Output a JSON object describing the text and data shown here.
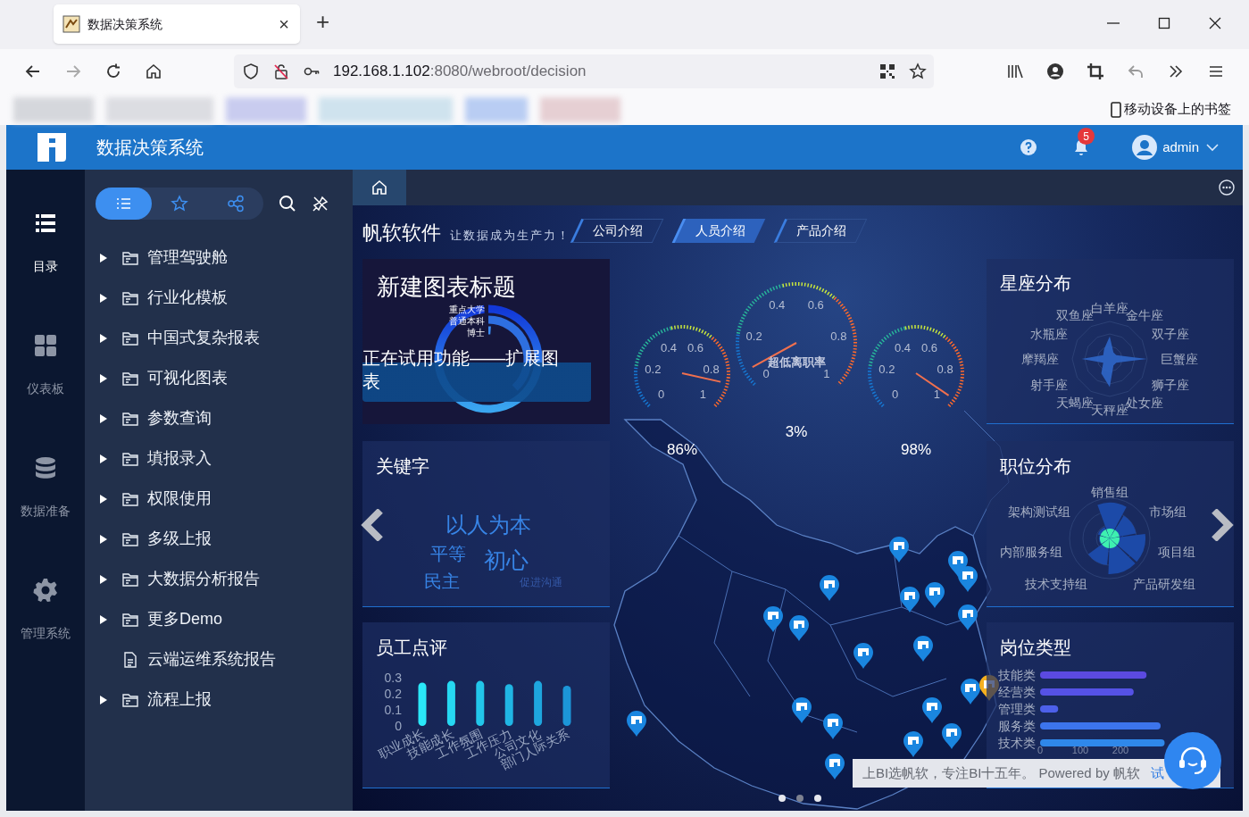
{
  "browser": {
    "tab_title": "数据决策系统",
    "tab_close": "×",
    "new_tab": "+",
    "url_host": "192.168.1.102",
    "url_rest": ":8080/webroot/decision",
    "bookmark": "移动设备上的书签"
  },
  "app": {
    "title": "数据决策系统",
    "notifications": "5",
    "user": "admin"
  },
  "nav": [
    {
      "label": "目录",
      "kind": "list",
      "selected": true
    },
    {
      "label": "仪表板",
      "kind": "dashboard",
      "selected": false
    },
    {
      "label": "数据准备",
      "kind": "database",
      "selected": false
    },
    {
      "label": "管理系统",
      "kind": "gear",
      "selected": false
    }
  ],
  "panel_tabs": [
    {
      "kind": "list",
      "selected": true
    },
    {
      "kind": "star",
      "selected": false
    },
    {
      "kind": "share",
      "selected": false
    }
  ],
  "tree": [
    {
      "label": "管理驾驶舱",
      "kind": "folder"
    },
    {
      "label": "行业化模板",
      "kind": "folder"
    },
    {
      "label": "中国式复杂报表",
      "kind": "folder"
    },
    {
      "label": "可视化图表",
      "kind": "folder"
    },
    {
      "label": "参数查询",
      "kind": "folder"
    },
    {
      "label": "填报录入",
      "kind": "folder"
    },
    {
      "label": "权限使用",
      "kind": "folder"
    },
    {
      "label": "多级上报",
      "kind": "folder"
    },
    {
      "label": "大数据分析报告",
      "kind": "folder"
    },
    {
      "label": "更多Demo",
      "kind": "folder"
    },
    {
      "label": "云端运维系统报告",
      "kind": "file"
    },
    {
      "label": "流程上报",
      "kind": "folder"
    }
  ],
  "dashboard": {
    "brand": "帆软软件",
    "slogan": "让数据成为生产力！",
    "tabs": [
      {
        "label": "公司介绍",
        "selected": false
      },
      {
        "label": "人员介绍",
        "selected": true
      },
      {
        "label": "产品介绍",
        "selected": false
      }
    ],
    "rings_card": {
      "title": "新建图表标题",
      "labels": [
        "重点大学",
        "普通本科",
        "博士"
      ],
      "trial_notice": "正在试用功能——扩展图表"
    },
    "gauges": [
      {
        "ticks": [
          "0",
          "0.2",
          "0.4",
          "0.6",
          "0.8",
          "1"
        ],
        "value": "86%"
      },
      {
        "ticks": [
          "0",
          "0.2",
          "0.4",
          "0.6",
          "0.8",
          "1"
        ],
        "title": "超低离职率",
        "value": "3%"
      },
      {
        "ticks": [
          "0",
          "0.2",
          "0.4",
          "0.6",
          "0.8",
          "1"
        ],
        "value": "98%"
      }
    ],
    "keywords_card": {
      "title": "关键字",
      "words": [
        "以人为本",
        "平等",
        "初心",
        "民主",
        "促进沟通"
      ]
    },
    "reviews_card": {
      "title": "员工点评",
      "chart_data": {
        "type": "bar",
        "categories": [
          "职业成长",
          "技能成长",
          "工作氛围",
          "工作压力",
          "公司文化",
          "部门人际关系"
        ],
        "values": [
          0.27,
          0.28,
          0.28,
          0.26,
          0.28,
          0.25
        ],
        "ylim": [
          0,
          0.3
        ],
        "yticks": [
          0,
          0.1,
          0.2,
          0.3
        ]
      }
    },
    "zodiac_card": {
      "title": "星座分布",
      "labels": [
        "白羊座",
        "金牛座",
        "双子座",
        "巨蟹座",
        "狮子座",
        "处女座",
        "天秤座",
        "天蝎座",
        "射手座",
        "摩羯座",
        "水瓶座",
        "双鱼座"
      ]
    },
    "roles_card": {
      "title": "职位分布",
      "labels": [
        "销售组",
        "架构测试组",
        "市场组",
        "内部服务组",
        "项目组",
        "技术支持组",
        "产品研发组"
      ]
    },
    "jobs_card": {
      "title": "岗位类型",
      "chart_data": {
        "type": "bar",
        "orientation": "horizontal",
        "categories": [
          "技能类",
          "经营类",
          "管理类",
          "服务类",
          "技术类"
        ],
        "values": [
          265,
          233,
          45,
          300,
          310
        ],
        "xticks": [
          0,
          100,
          200
        ],
        "xlim": [
          0,
          320
        ]
      }
    },
    "banner": {
      "text": "上BI选帆软，专注BI十五年。 Powered by 帆软",
      "link": "试"
    },
    "carousel": [
      {
        "selected": false
      },
      {
        "selected": true
      },
      {
        "selected": false
      }
    ]
  }
}
